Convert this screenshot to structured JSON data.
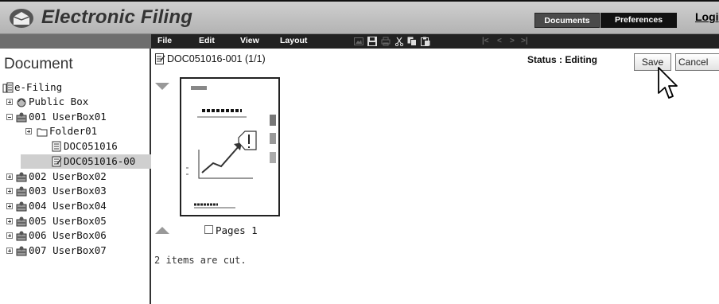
{
  "header": {
    "title": "Electronic Filing",
    "tabs": [
      "Documents",
      "Preferences"
    ],
    "login": "Logi"
  },
  "menubar": {
    "items": [
      "File",
      "Edit",
      "View",
      "Layout"
    ],
    "toolbar_icons": [
      "image-icon",
      "save-icon",
      "print-icon",
      "cut-icon",
      "copy-icon",
      "paste-icon"
    ],
    "nav_glyphs": [
      "|<",
      "<",
      ">",
      ">|"
    ]
  },
  "tree": {
    "title": "Document",
    "root": "e-Filing",
    "items": [
      {
        "label": "Public Box",
        "icon": "public-box-icon",
        "expander": "plus"
      },
      {
        "label": "001 UserBox01",
        "icon": "user-box-icon",
        "expander": "minus"
      },
      {
        "label": "Folder01",
        "icon": "folder-icon",
        "expander": "plus"
      },
      {
        "label": "DOC051016",
        "icon": "document-icon",
        "expander": ""
      },
      {
        "label": "DOC051016-00",
        "icon": "document-editing-icon",
        "expander": "",
        "selected": true
      },
      {
        "label": "002 UserBox02",
        "icon": "user-box-icon",
        "expander": "plus"
      },
      {
        "label": "003 UserBox03",
        "icon": "user-box-icon",
        "expander": "plus"
      },
      {
        "label": "004 UserBox04",
        "icon": "user-box-icon",
        "expander": "plus"
      },
      {
        "label": "005 UserBox05",
        "icon": "user-box-icon",
        "expander": "plus"
      },
      {
        "label": "006 UserBox06",
        "icon": "user-box-icon",
        "expander": "plus"
      },
      {
        "label": "007 UserBox07",
        "icon": "user-box-icon",
        "expander": "plus"
      }
    ]
  },
  "document": {
    "title": "DOC051016-001 (1/1)",
    "status": "Status : Editing",
    "save_label": "Save",
    "cancel_label": "Cancel",
    "page_label": "Pages 1",
    "page_checked": false,
    "cut_message": "2 items are cut."
  }
}
